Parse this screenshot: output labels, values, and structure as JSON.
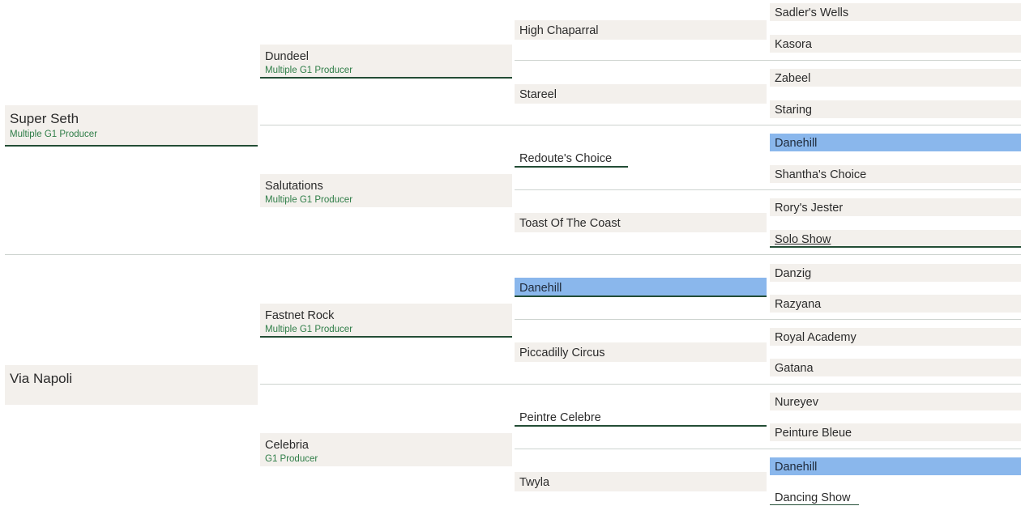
{
  "pedigree": {
    "gen1": [
      {
        "name": "Super Seth",
        "note": "Multiple G1 Producer"
      },
      {
        "name": "Via Napoli",
        "note": ""
      }
    ],
    "gen2": [
      {
        "name": "Dundeel",
        "note": "Multiple G1 Producer"
      },
      {
        "name": "Salutations",
        "note": "Multiple G1 Producer"
      },
      {
        "name": "Fastnet Rock",
        "note": "Multiple G1 Producer"
      },
      {
        "name": "Celebria",
        "note": "G1 Producer"
      }
    ],
    "gen3": [
      {
        "name": "High Chaparral"
      },
      {
        "name": "Stareel"
      },
      {
        "name": "Redoute's Choice"
      },
      {
        "name": "Toast Of The Coast"
      },
      {
        "name": "Danehill"
      },
      {
        "name": "Piccadilly Circus"
      },
      {
        "name": "Peintre Celebre"
      },
      {
        "name": "Twyla"
      }
    ],
    "gen4": [
      {
        "name": "Sadler's Wells"
      },
      {
        "name": "Kasora"
      },
      {
        "name": "Zabeel"
      },
      {
        "name": "Staring"
      },
      {
        "name": "Danehill"
      },
      {
        "name": "Shantha's Choice"
      },
      {
        "name": "Rory's Jester"
      },
      {
        "name": "Solo Show"
      },
      {
        "name": "Danzig"
      },
      {
        "name": "Razyana"
      },
      {
        "name": "Royal Academy"
      },
      {
        "name": "Gatana"
      },
      {
        "name": "Nureyev"
      },
      {
        "name": "Peinture Bleue"
      },
      {
        "name": "Danehill"
      },
      {
        "name": "Dancing Show"
      }
    ]
  },
  "colors": {
    "cell_bg": "#f3f0ec",
    "highlight": "#8ab7ec",
    "accent_line": "#234d35",
    "producer_text": "#2e7d47"
  }
}
